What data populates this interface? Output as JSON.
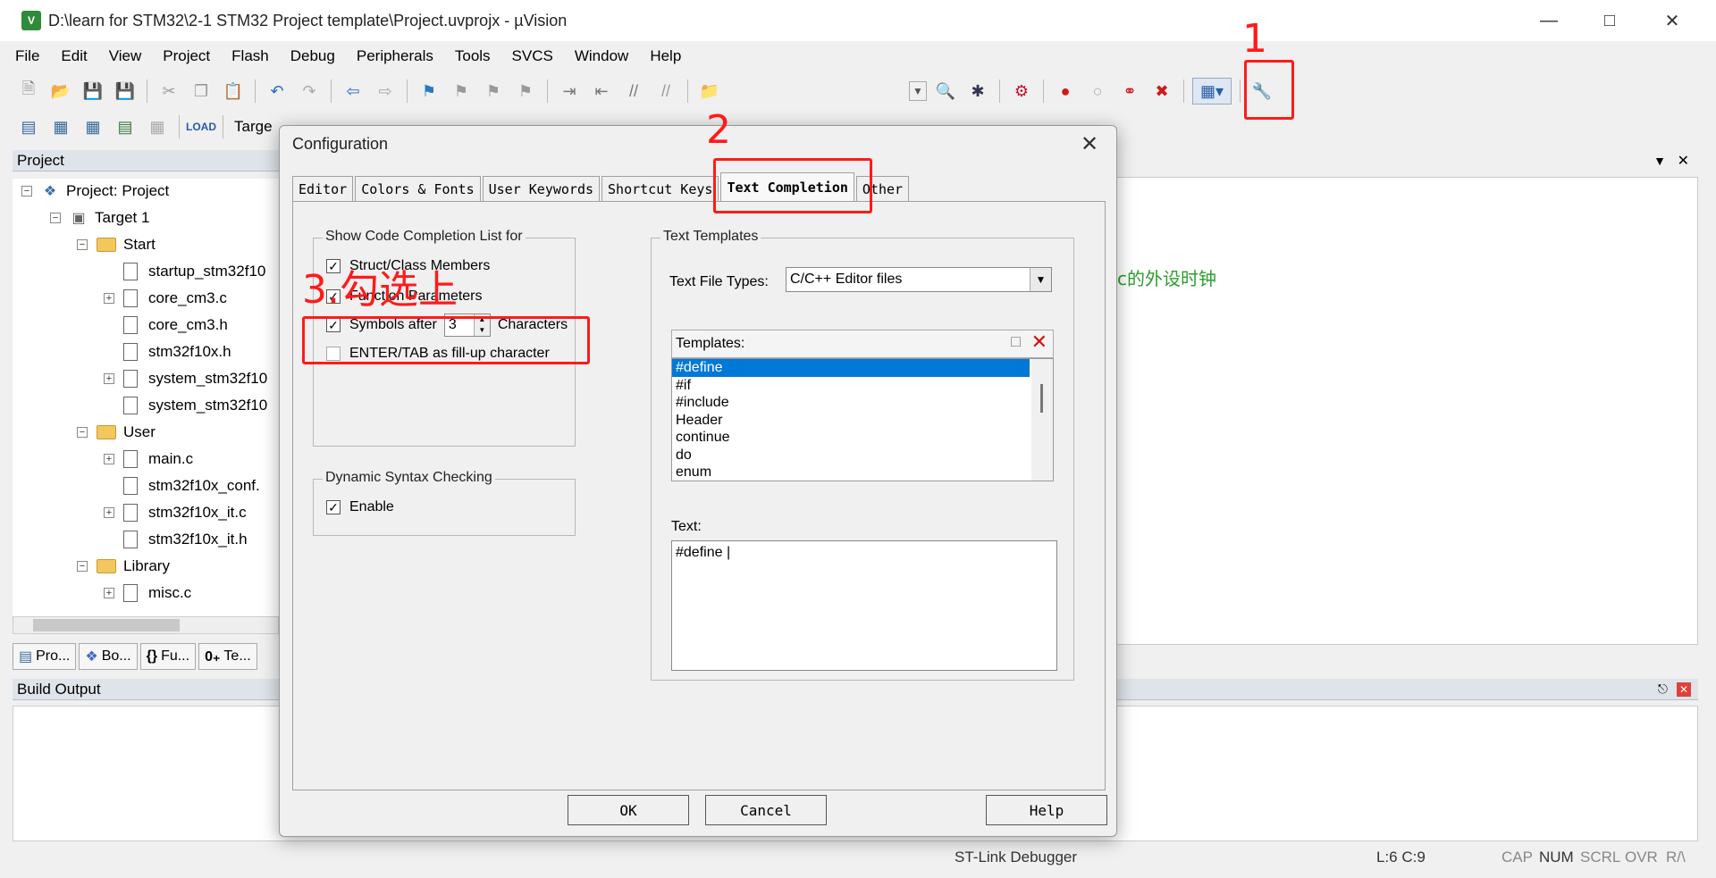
{
  "window": {
    "title": "D:\\learn for STM32\\2-1 STM32 Project template\\Project.uvprojx - µVision",
    "app_icon": "V"
  },
  "menu": [
    "File",
    "Edit",
    "View",
    "Project",
    "Flash",
    "Debug",
    "Peripherals",
    "Tools",
    "SVCS",
    "Window",
    "Help"
  ],
  "toolbar2": {
    "target_label": "Targe"
  },
  "project_panel": {
    "title": "Project",
    "items": [
      {
        "label": "Project: Project"
      },
      {
        "label": "Target 1"
      },
      {
        "label": "Start"
      },
      {
        "label": "startup_stm32f10"
      },
      {
        "label": "core_cm3.c"
      },
      {
        "label": "core_cm3.h"
      },
      {
        "label": "stm32f10x.h"
      },
      {
        "label": "system_stm32f10"
      },
      {
        "label": "system_stm32f10"
      },
      {
        "label": "User"
      },
      {
        "label": "main.c"
      },
      {
        "label": "stm32f10x_conf."
      },
      {
        "label": "stm32f10x_it.c"
      },
      {
        "label": "stm32f10x_it.h"
      },
      {
        "label": "Library"
      },
      {
        "label": "misc.c"
      }
    ],
    "bottom_tabs": [
      "Pro...",
      "Bo...",
      "Fu...",
      "Te..."
    ]
  },
  "editor": {
    "visible_text": "c的外设时钟"
  },
  "build_output": {
    "title": "Build Output"
  },
  "status": {
    "debugger": "ST-Link Debugger",
    "position": "L:6 C:9",
    "cap": "CAP",
    "num": "NUM",
    "scrl": "SCRL",
    "ovr": "OVR",
    "rw": "R/\\"
  },
  "annotations": {
    "step1": "1",
    "step2": "2",
    "step3": "3.勾选上"
  },
  "dialog": {
    "title": "Configuration",
    "tabs": [
      "Editor",
      "Colors & Fonts",
      "User Keywords",
      "Shortcut Keys",
      "Text Completion",
      "Other"
    ],
    "active_tab": "Text Completion",
    "code_completion": {
      "group_label": "Show Code Completion List for",
      "struct_members": {
        "label": "Struct/Class Members",
        "checked": true
      },
      "function_params": {
        "label": "Function Parameters",
        "checked": true
      },
      "symbols_after": {
        "label": "Symbols after",
        "value": "3",
        "suffix": "Characters",
        "checked": true
      },
      "enter_tab": {
        "label": "ENTER/TAB as fill-up character",
        "checked": false
      }
    },
    "syntax": {
      "group_label": "Dynamic Syntax Checking",
      "enable": {
        "label": "Enable",
        "checked": true
      }
    },
    "text_templates": {
      "group_label": "Text Templates",
      "file_types_label": "Text File Types:",
      "file_types_value": "C/C++ Editor files",
      "templates_label": "Templates:",
      "templates": [
        "#define",
        "#if",
        "#include",
        "Header",
        "continue",
        "do",
        "enum"
      ],
      "selected_template": "#define",
      "text_label": "Text:",
      "text_value": "#define |"
    },
    "buttons": {
      "ok": "OK",
      "cancel": "Cancel",
      "help": "Help"
    }
  }
}
